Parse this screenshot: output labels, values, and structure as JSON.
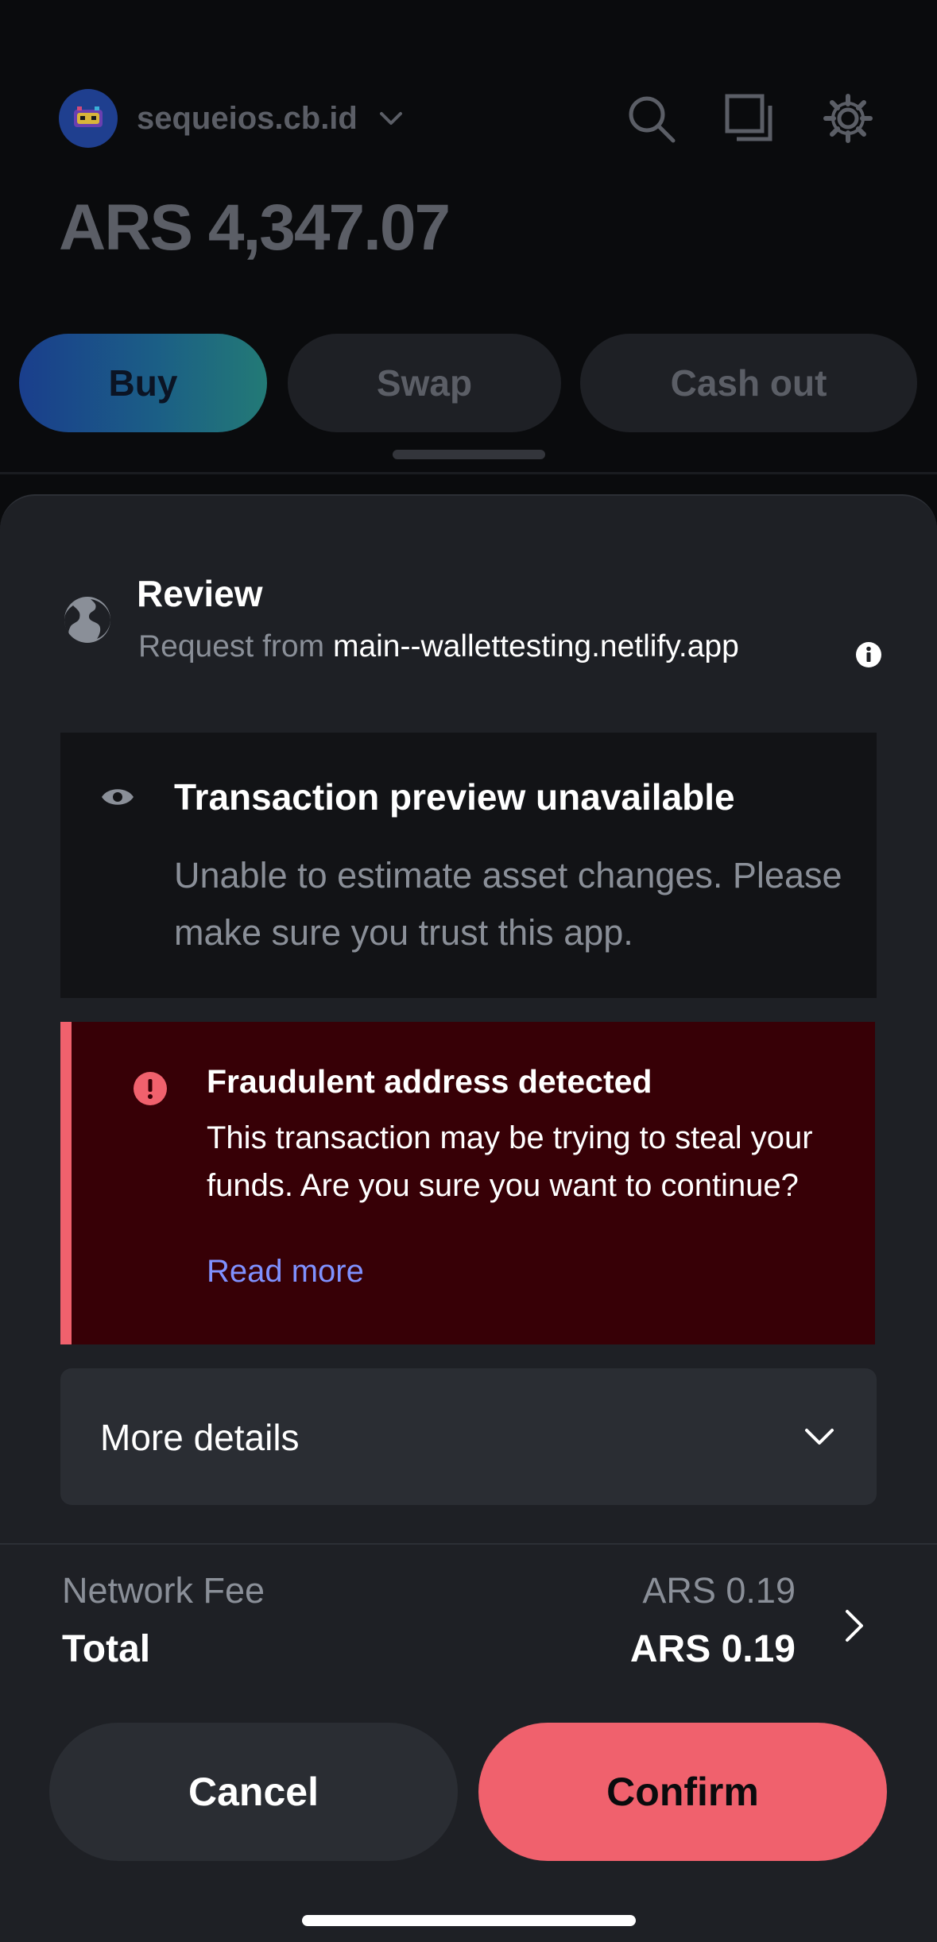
{
  "wallet": {
    "account_name": "sequeios.cb.id",
    "balance": "ARS 4,347.07",
    "actions": {
      "buy": "Buy",
      "swap": "Swap",
      "cash_out": "Cash out"
    },
    "icons": [
      "search-icon",
      "copy-icon",
      "gear-icon"
    ]
  },
  "review": {
    "title": "Review",
    "request_prefix": "Request from",
    "request_host": "main--wallettesting.netlify.app"
  },
  "preview": {
    "title": "Transaction preview unavailable",
    "text": "Unable to estimate asset changes. Please make sure you trust this app."
  },
  "fraud": {
    "title": "Fraudulent address detected",
    "text": "This transaction may be trying to steal your funds. Are you sure you want to continue?",
    "link": "Read more"
  },
  "more_details": {
    "label": "More details"
  },
  "fees": {
    "network_fee_label": "Network Fee",
    "network_fee_value": "ARS 0.19",
    "total_label": "Total",
    "total_value": "ARS 0.19"
  },
  "buttons": {
    "cancel": "Cancel",
    "confirm": "Confirm"
  },
  "colors": {
    "danger": "#f0616d",
    "danger_bg": "#370006",
    "link": "#7f91ff",
    "sheet_bg": "#1e2025"
  }
}
